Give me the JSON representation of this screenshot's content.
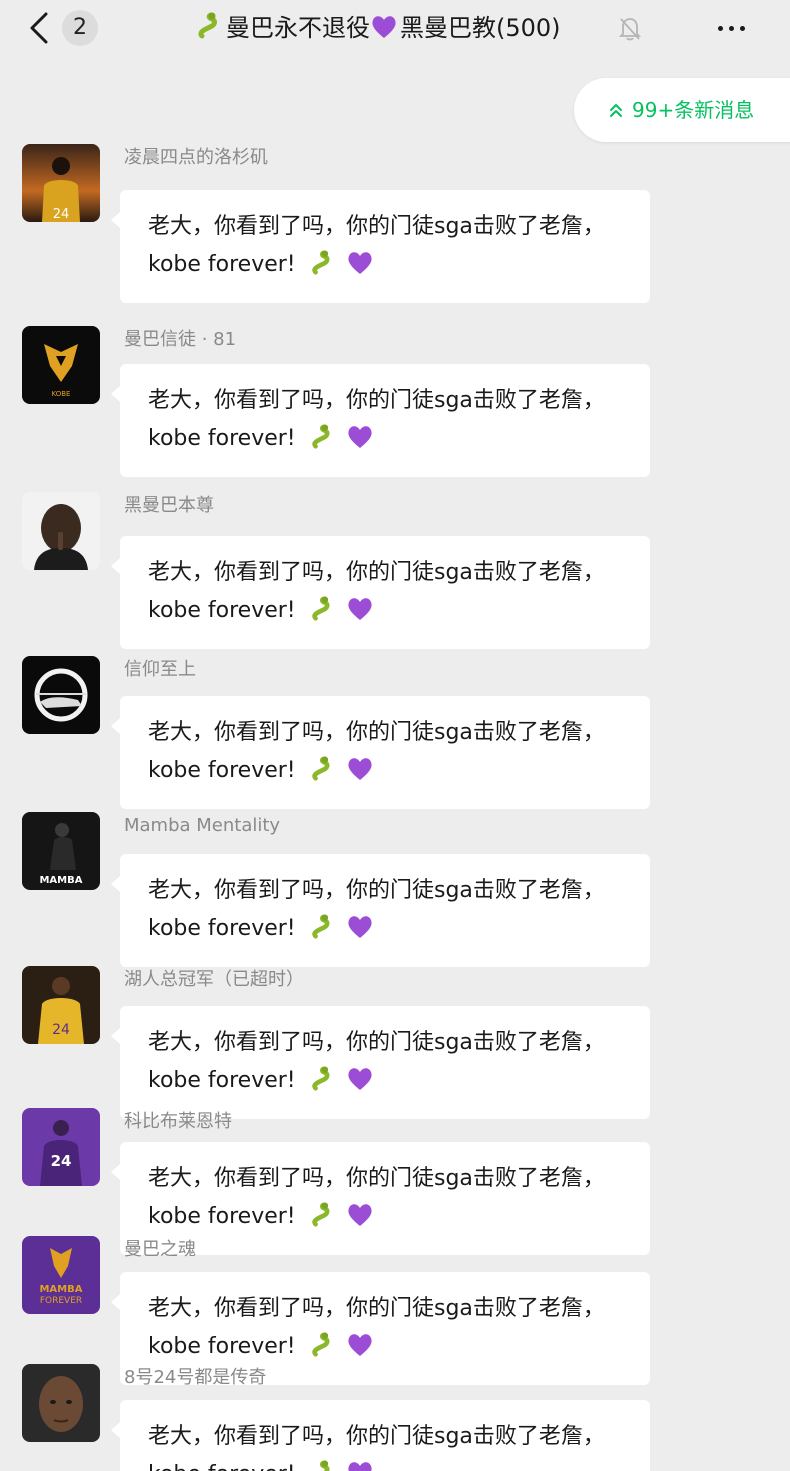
{
  "nav": {
    "back_count": "2",
    "title_part1": "曼巴永不退役",
    "title_part2": "黑曼巴教(500)",
    "title_emoji_1": "snake-icon",
    "title_emoji_2": "purple-heart-icon"
  },
  "new_messages": {
    "label": "99+条新消息",
    "icon": "double-chevron-up-icon",
    "color": "#07c160"
  },
  "colors": {
    "background": "#ededed",
    "bubble": "#ffffff",
    "sender_name": "#8a8a8a"
  },
  "messages": [
    {
      "sender": "凌晨四点的洛杉矶",
      "avatar": "kobe-24-sunset-avatar",
      "line1": "老大，你看到了吗，你的门徒sga击败了老詹，",
      "line2": "kobe forever!"
    },
    {
      "sender": "曼巴信徒 · 81",
      "avatar": "kobe-sheath-logo-avatar",
      "line1": "老大，你看到了吗，你的门徒sga击败了老詹，",
      "line2": "kobe forever!"
    },
    {
      "sender": "黑曼巴本尊",
      "avatar": "kobe-portrait-avatar",
      "line1": "老大，你看到了吗，你的门徒sga击败了老詹，",
      "line2": "kobe forever!"
    },
    {
      "sender": "信仰至上",
      "avatar": "helicopter-ring-avatar",
      "line1": "老大，你看到了吗，你的门徒sga击败了老詹，",
      "line2": "kobe forever!"
    },
    {
      "sender": "Mamba Mentality",
      "avatar": "mamba-dark-avatar",
      "line1": "老大，你看到了吗，你的门徒sga击败了老詹，",
      "line2": "kobe forever!"
    },
    {
      "sender": "湖人总冠军（已超时）",
      "avatar": "kobe-gold-jersey-avatar",
      "line1": "老大，你看到了吗，你的门徒sga击败了老詹，",
      "line2": "kobe forever!"
    },
    {
      "sender": "科比布莱恩特",
      "avatar": "kobe-purple-jersey-avatar",
      "line1": "老大，你看到了吗，你的门徒sga击败了老詹，",
      "line2": "kobe forever!"
    },
    {
      "sender": "曼巴之魂",
      "avatar": "mamba-forever-avatar",
      "line1": "老大，你看到了吗，你的门徒sga击败了老詹，",
      "line2": "kobe forever!"
    },
    {
      "sender": "8号24号都是传奇",
      "avatar": "kobe-face-avatar",
      "line1": "老大，你看到了吗，你的门徒sga击败了老詹，",
      "line2": "kobe forever!"
    }
  ]
}
